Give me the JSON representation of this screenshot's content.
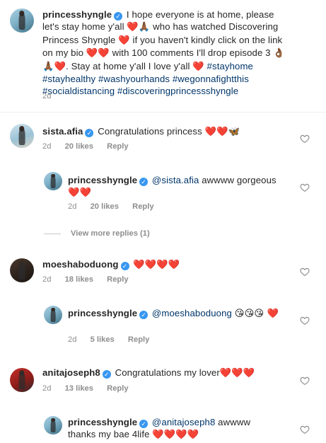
{
  "caption": {
    "username": "princesshyngle",
    "text_1": "I hope everyone is at home, please let's stay home y'all ",
    "emoji_1": "❤️🙏🏾",
    "text_2": " who has watched Discovering Princess Shyngle ",
    "emoji_2": "❤️",
    "text_3": " if you haven't kindly click on the link on my bio ",
    "emoji_3": "❤️❤️",
    "text_4": " with 100 comments I'll drop episode 3 ",
    "emoji_4": "👌🏾🙏🏾❤️",
    "text_5": ". Stay at home y'all I love y'all ",
    "emoji_5": "❤️",
    "hashtags_1": " #stayhome #stayhealthy #washyourhands #wegonnafightthis #socialdistancing #discoveringprincessshyngle",
    "time": "2d"
  },
  "comments": [
    {
      "username": "sista.afia",
      "text": "Congratulations princess ",
      "emoji": "❤️❤️🦋",
      "time": "2d",
      "likes": "20 likes",
      "reply": "Reply"
    },
    {
      "username": "princesshyngle",
      "mention": "@sista.afia",
      "text": " awwww gorgeous ",
      "emoji": "❤️❤️",
      "time": "2d",
      "likes": "20 likes",
      "reply": "Reply"
    },
    {
      "username": "moeshaboduong",
      "text": " ",
      "emoji": "❤️❤️❤️❤️",
      "time": "2d",
      "likes": "18 likes",
      "reply": "Reply"
    },
    {
      "username": "princesshyngle",
      "mention": "@moeshaboduong",
      "text": " ",
      "emoji": "😘😘😘 ❤️",
      "time": "2d",
      "likes": "5 likes",
      "reply": "Reply"
    },
    {
      "username": "anitajoseph8",
      "text": "Congratulations my lover",
      "emoji": "❤️❤️❤️",
      "time": "2d",
      "likes": "13 likes",
      "reply": "Reply"
    },
    {
      "username": "princesshyngle",
      "mention": "@anitajoseph8",
      "text": " awwww thanks my bae 4life ",
      "emoji": "❤️❤️❤️❤️"
    }
  ],
  "view_more": "View more replies (1)",
  "icons": {
    "verified": "verified-badge-icon",
    "like": "heart-outline-icon"
  },
  "colors": {
    "verified": "#3897f0",
    "hashtag": "#003569",
    "meta": "#8e8e8e",
    "heart": "#e0245e"
  }
}
